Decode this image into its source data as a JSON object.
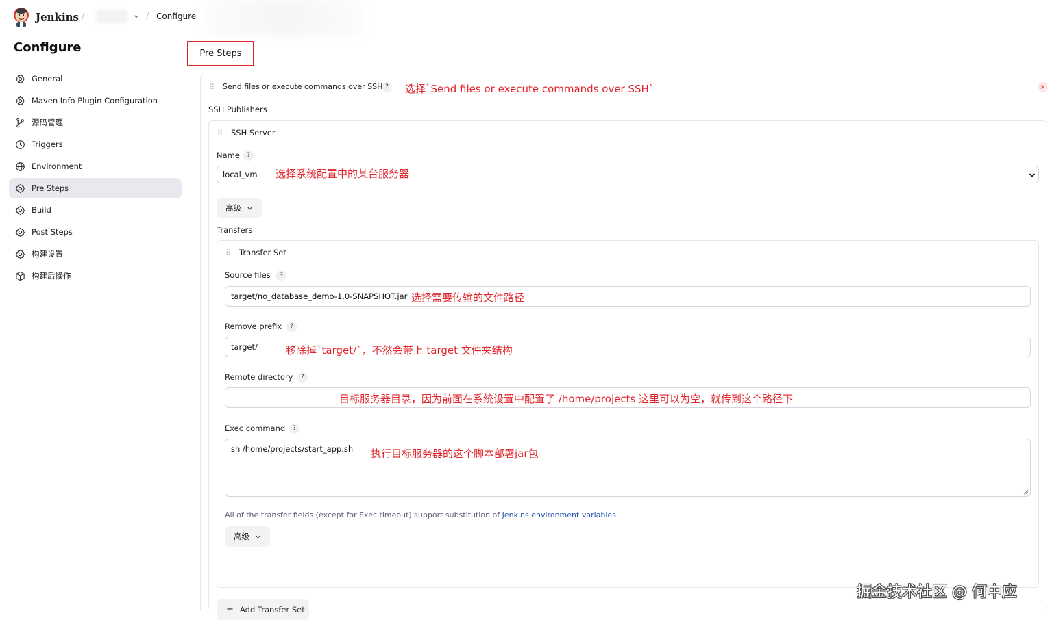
{
  "header": {
    "brand": "Jenkins",
    "separator": "/",
    "breadcrumb_current": "Configure"
  },
  "page_title": "Configure",
  "sidebar": {
    "items": [
      {
        "label": "General",
        "icon": "gear-icon"
      },
      {
        "label": "Maven Info Plugin Configuration",
        "icon": "gear-icon"
      },
      {
        "label": "源码管理",
        "icon": "git-branch-icon"
      },
      {
        "label": "Triggers",
        "icon": "clock-icon"
      },
      {
        "label": "Environment",
        "icon": "globe-icon"
      },
      {
        "label": "Pre Steps",
        "icon": "gear-icon",
        "active": true
      },
      {
        "label": "Build",
        "icon": "gear-icon"
      },
      {
        "label": "Post Steps",
        "icon": "gear-icon"
      },
      {
        "label": "构建设置",
        "icon": "gear-icon"
      },
      {
        "label": "构建后操作",
        "icon": "cube-icon"
      }
    ]
  },
  "main": {
    "section_title": "Pre Steps",
    "step_title": "Send files or execute commands over SSH",
    "help": "?",
    "close": "×",
    "ssh_publishers_label": "SSH Publishers",
    "ssh_server_label": "SSH Server",
    "name_label": "Name",
    "name_value": "local_vm",
    "advanced_label": "高级",
    "transfers_label": "Transfers",
    "transfer_set_label": "Transfer Set",
    "source_files_label": "Source files",
    "source_files_value": "target/no_database_demo-1.0-SNAPSHOT.jar",
    "remove_prefix_label": "Remove prefix",
    "remove_prefix_value": "target/",
    "remote_directory_label": "Remote directory",
    "remote_directory_value": "",
    "exec_command_label": "Exec command",
    "exec_command_value": "sh /home/projects/start_app.sh",
    "note_text": "All of the transfer fields (except for Exec timeout) support substitution of ",
    "note_link": "Jenkins environment variables",
    "advanced2_label": "高级",
    "add_transfer_label": "Add Transfer Set"
  },
  "annotations": {
    "step": "选择`Send files or execute commands over SSH`",
    "name": "选择系统配置中的某台服务器",
    "source": "选择需要传输的文件路径",
    "prefix": "移除掉`target/`，不然会带上 target 文件夹结构",
    "remote": "目标服务器目录，因为前面在系统设置中配置了 /home/projects 这里可以为空，就传到这个路径下",
    "exec": "执行目标服务器的这个脚本部署jar包"
  },
  "watermark": "掘金技术社区 @ 何中应",
  "colors": {
    "accent_red": "#e0262c",
    "link_blue": "#2a55b7",
    "active_bg": "#e8e9ef"
  }
}
